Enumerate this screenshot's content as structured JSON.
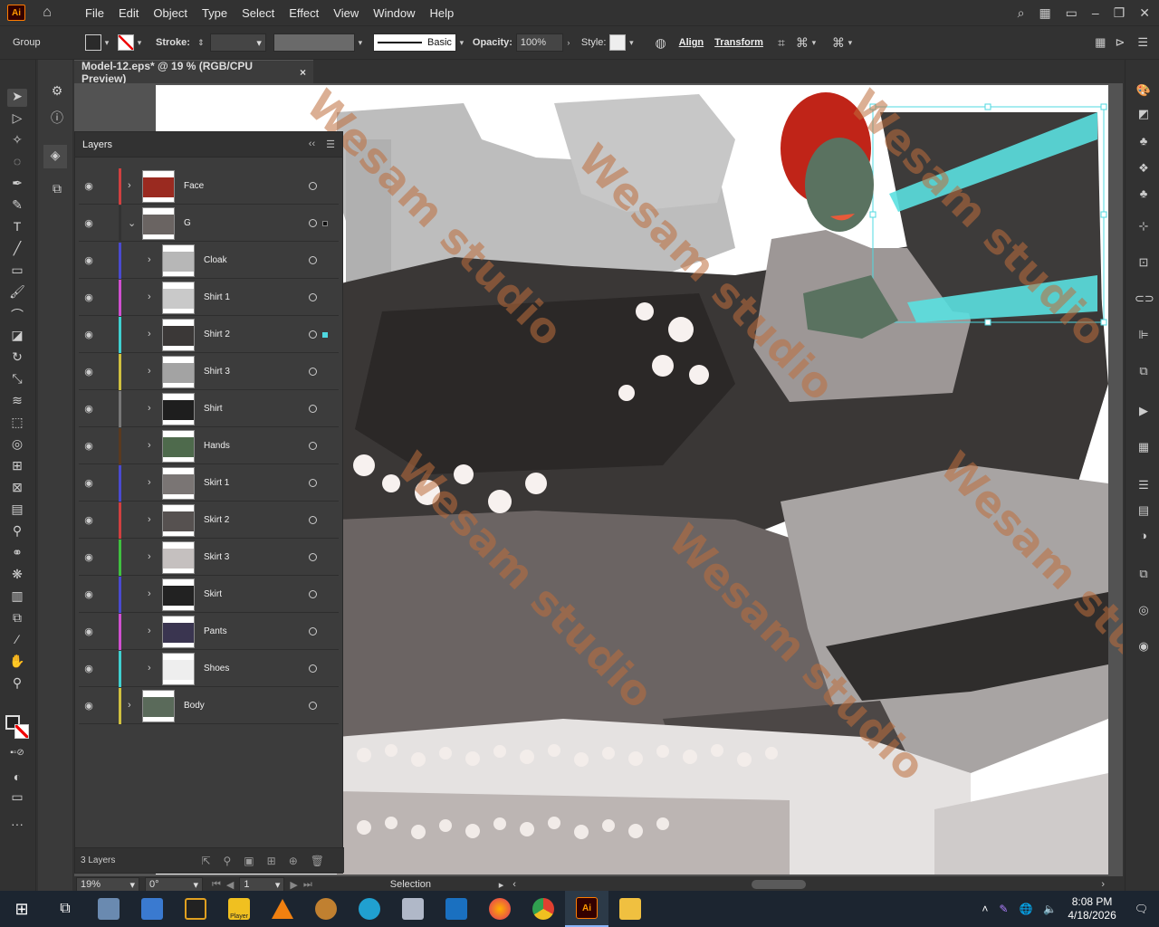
{
  "app": {
    "logo": "Ai"
  },
  "menu": [
    "File",
    "Edit",
    "Object",
    "Type",
    "Select",
    "Effect",
    "View",
    "Window",
    "Help"
  ],
  "control": {
    "selection_type": "Group",
    "stroke_label": "Stroke:",
    "stroke_style": "Basic",
    "opacity_label": "Opacity:",
    "opacity_value": "100%",
    "style_label": "Style:",
    "align_label": "Align",
    "transform_label": "Transform"
  },
  "document": {
    "tab_title": "Model-12.eps* @ 19 % (RGB/CPU Preview)",
    "close": "×"
  },
  "layers_panel": {
    "title": "Layers",
    "footer": "3 Layers",
    "rows": [
      {
        "name": "Face",
        "color": "#d04040",
        "level": 0,
        "expanded": false
      },
      {
        "name": "G",
        "color": "#333333",
        "level": 0,
        "expanded": true
      },
      {
        "name": "Cloak",
        "color": "#4a4ad0",
        "level": 1
      },
      {
        "name": "Shirt 1",
        "color": "#d050d0",
        "level": 1
      },
      {
        "name": "Shirt 2",
        "color": "#40d0d0",
        "level": 1
      },
      {
        "name": "Shirt 3",
        "color": "#d0c040",
        "level": 1
      },
      {
        "name": "Shirt",
        "color": "#777777",
        "level": 1
      },
      {
        "name": "Hands",
        "color": "#5a3a20",
        "level": 1
      },
      {
        "name": "Skirt 1",
        "color": "#4a4ad0",
        "level": 1
      },
      {
        "name": "Skirt 2",
        "color": "#d04040",
        "level": 1
      },
      {
        "name": "Skirt 3",
        "color": "#40c040",
        "level": 1
      },
      {
        "name": "Skirt",
        "color": "#4a4ad0",
        "level": 1
      },
      {
        "name": "Pants",
        "color": "#d050d0",
        "level": 1
      },
      {
        "name": "Shoes",
        "color": "#40d0d0",
        "level": 1
      },
      {
        "name": "Body",
        "color": "#d0c040",
        "level": 0,
        "expanded": false
      }
    ]
  },
  "status": {
    "zoom": "19%",
    "rotation": "0°",
    "artboard": "1",
    "tool": "Selection"
  },
  "watermark": "Wesam studio",
  "taskbar": {
    "time": "8:08 PM",
    "date": "4/18/2026",
    "player_label": "Player"
  }
}
